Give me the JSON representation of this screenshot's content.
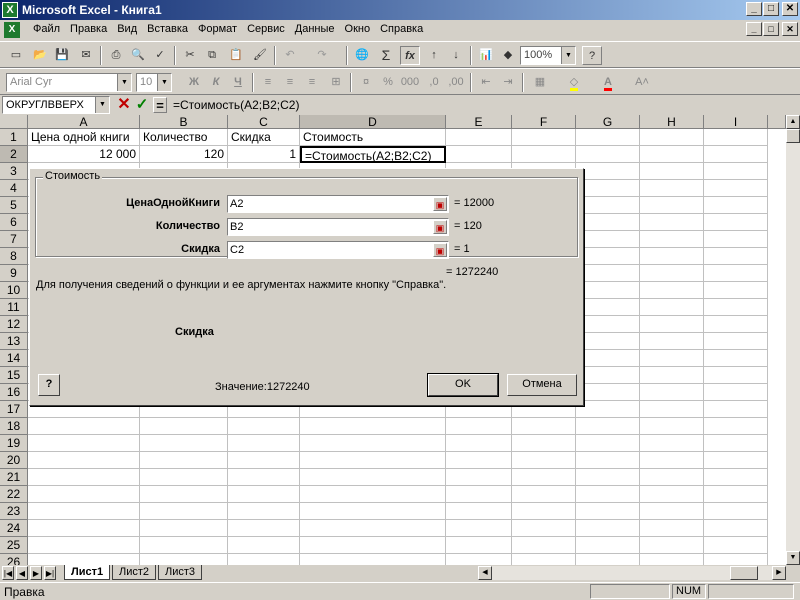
{
  "window": {
    "title": "Microsoft Excel - Книга1",
    "app_icon_glyph": "X",
    "minimize": "_",
    "maximize": "□",
    "close": "✕"
  },
  "menu": {
    "items": [
      "Файл",
      "Правка",
      "Вид",
      "Вставка",
      "Формат",
      "Сервис",
      "Данные",
      "Окно",
      "Справка"
    ]
  },
  "toolbar": {
    "zoom": "100%",
    "font_name": "Arial Cyr",
    "font_size": "10",
    "bold": "Ж",
    "italic": "К",
    "underline": "Ч",
    "percent": "%",
    "sigma": "Σ",
    "fx": "fx"
  },
  "formula_bar": {
    "name_box": "ОКРУГЛВВЕРХ",
    "cancel": "✕",
    "enter": "✓",
    "equals": "=",
    "formula": "=Стоимость(A2;B2;C2)"
  },
  "grid": {
    "columns": [
      "A",
      "B",
      "C",
      "D",
      "E",
      "F",
      "G",
      "H",
      "I"
    ],
    "rows": [
      "1",
      "2",
      "3",
      "4",
      "5",
      "6",
      "7",
      "8",
      "9",
      "10",
      "11",
      "12",
      "13",
      "14",
      "15",
      "16",
      "17",
      "18",
      "19",
      "20",
      "21",
      "22",
      "23",
      "24",
      "25",
      "26"
    ],
    "cells": {
      "A1": "Цена одной книги",
      "B1": "Количество",
      "C1": "Скидка",
      "D1": "Стоимость",
      "A2": "12 000",
      "B2": "120",
      "C2": "1",
      "D2": "=Стоимость(A2;B2;C2)"
    }
  },
  "sheets": {
    "tabs": [
      "Лист1",
      "Лист2",
      "Лист3"
    ]
  },
  "status": {
    "text": "Правка",
    "num": "NUM"
  },
  "dialog": {
    "group_title": "Стоимость",
    "args": [
      {
        "label": "ЦенаОднойКниги",
        "value": "A2",
        "result": "= 12000"
      },
      {
        "label": "Количество",
        "value": "B2",
        "result": "= 120"
      },
      {
        "label": "Скидка",
        "value": "C2",
        "result": "= 1"
      }
    ],
    "total_result": "= 1272240",
    "help_text": "Для получения сведений о функции и ее аргументах нажмите кнопку \"Справка\".",
    "current_arg": "Скидка",
    "value_label": "Значение:1272240",
    "help_button": "?",
    "ok_label": "OK",
    "cancel_label": "Отмена"
  }
}
